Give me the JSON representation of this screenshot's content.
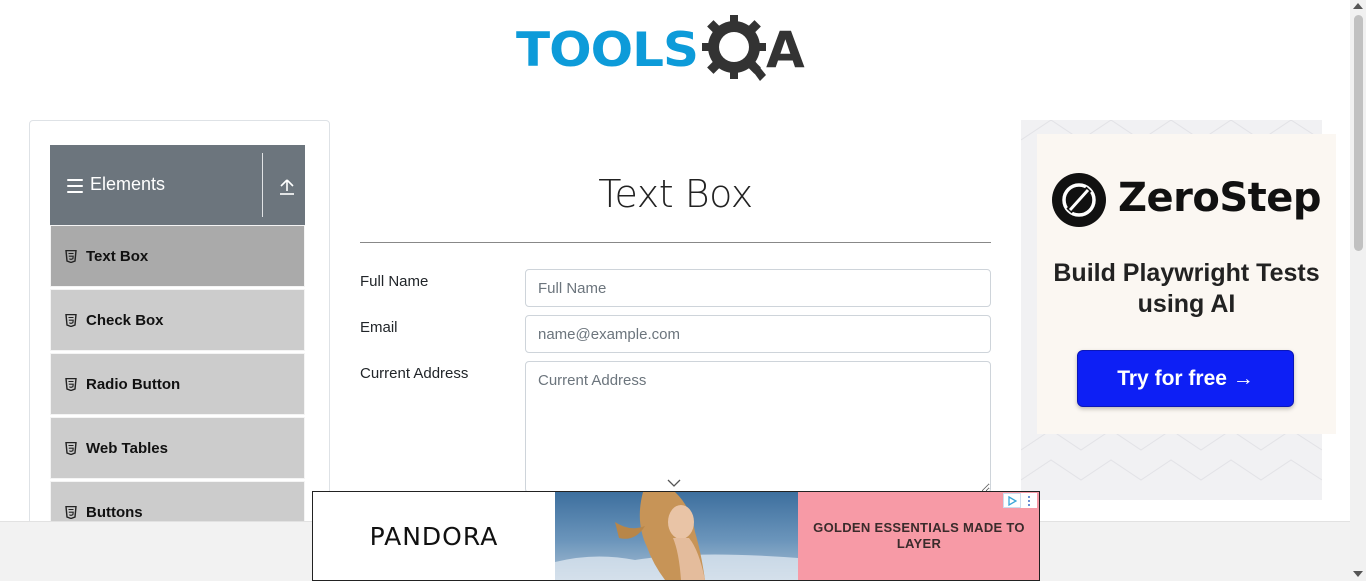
{
  "header": {
    "logo_text_left": "TOOLS",
    "logo_text_right": "A",
    "logo_icon": "gear-magnifier-icon"
  },
  "sidebar": {
    "group_title": "Elements",
    "group_icon": "hamburger-icon",
    "collapse_icon": "upload-arrow-icon",
    "items": [
      {
        "label": "Text Box",
        "icon": "html5-icon",
        "active": true
      },
      {
        "label": "Check Box",
        "icon": "html5-icon",
        "active": false
      },
      {
        "label": "Radio Button",
        "icon": "html5-icon",
        "active": false
      },
      {
        "label": "Web Tables",
        "icon": "html5-icon",
        "active": false
      },
      {
        "label": "Buttons",
        "icon": "html5-icon",
        "active": false
      }
    ]
  },
  "main": {
    "title": "Text Box",
    "fields": {
      "full_name": {
        "label": "Full Name",
        "placeholder": "Full Name",
        "value": ""
      },
      "email": {
        "label": "Email",
        "placeholder": "name@example.com",
        "value": ""
      },
      "current_address": {
        "label": "Current Address",
        "placeholder": "Current Address",
        "value": ""
      }
    }
  },
  "side_ad": {
    "brand": "ZeroStep",
    "tagline": "Build Playwright Tests using AI",
    "cta": "Try for free →",
    "cta_color": "#0d1ff5"
  },
  "bottom_ad": {
    "brand": "PANDORA",
    "text": "GOLDEN ESSENTIALS MADE TO LAYER",
    "bg_color": "#f79aa6"
  },
  "colors": {
    "logo_blue": "#0d9bd9",
    "group_header": "#6c757d",
    "menu_item": "#cccccc",
    "menu_item_active": "#aaaaaa"
  }
}
